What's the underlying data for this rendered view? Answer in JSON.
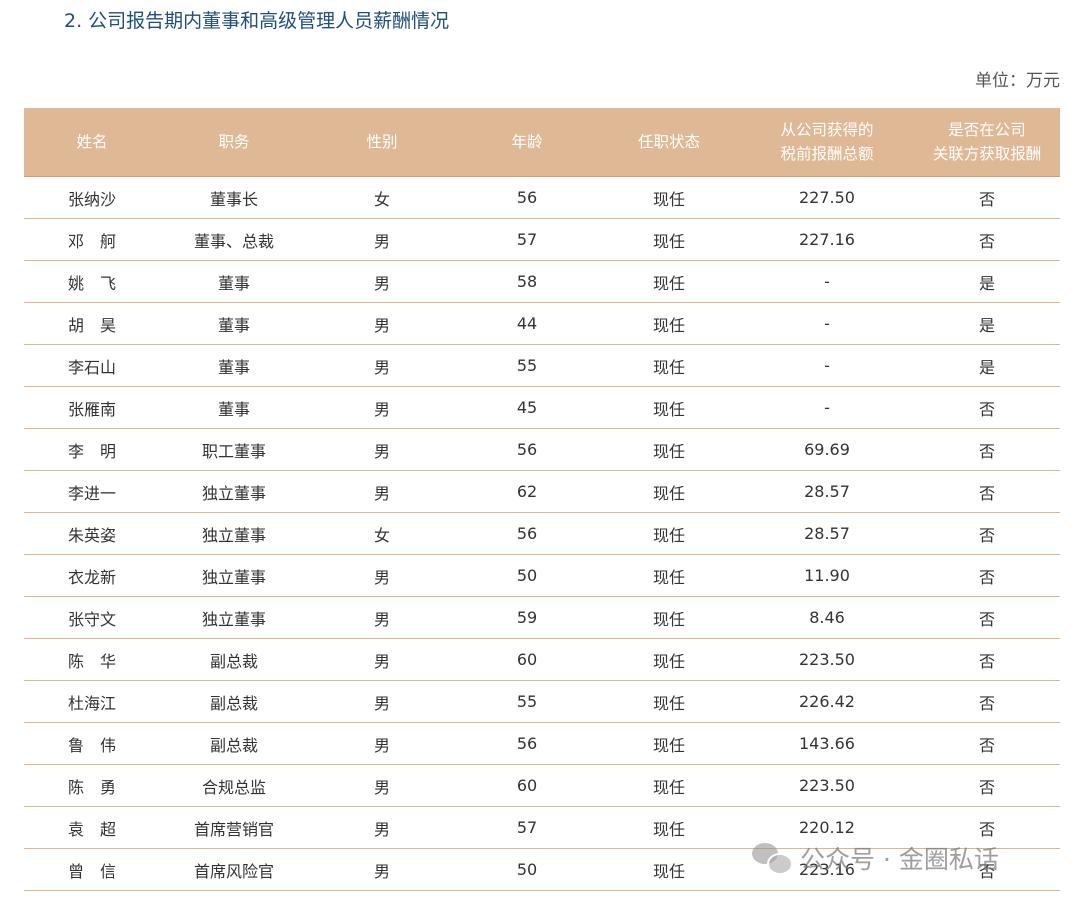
{
  "title": "2. 公司报告期内董事和高级管理人员薪酬情况",
  "unit": "单位：万元",
  "table": {
    "headers": [
      [
        "姓名"
      ],
      [
        "职务"
      ],
      [
        "性别"
      ],
      [
        "年龄"
      ],
      [
        "任职状态"
      ],
      [
        "从公司获得的",
        "税前报酬总额"
      ],
      [
        "是否在公司",
        "关联方获取报酬"
      ]
    ],
    "rows": [
      [
        "张纳沙",
        "董事长",
        "女",
        "56",
        "现任",
        "227.50",
        "否"
      ],
      [
        "邓　舸",
        "董事、总裁",
        "男",
        "57",
        "现任",
        "227.16",
        "否"
      ],
      [
        "姚　飞",
        "董事",
        "男",
        "58",
        "现任",
        "-",
        "是"
      ],
      [
        "胡　昊",
        "董事",
        "男",
        "44",
        "现任",
        "-",
        "是"
      ],
      [
        "李石山",
        "董事",
        "男",
        "55",
        "现任",
        "-",
        "是"
      ],
      [
        "张雁南",
        "董事",
        "男",
        "45",
        "现任",
        "-",
        "否"
      ],
      [
        "李　明",
        "职工董事",
        "男",
        "56",
        "现任",
        "69.69",
        "否"
      ],
      [
        "李进一",
        "独立董事",
        "男",
        "62",
        "现任",
        "28.57",
        "否"
      ],
      [
        "朱英姿",
        "独立董事",
        "女",
        "56",
        "现任",
        "28.57",
        "否"
      ],
      [
        "衣龙新",
        "独立董事",
        "男",
        "50",
        "现任",
        "11.90",
        "否"
      ],
      [
        "张守文",
        "独立董事",
        "男",
        "59",
        "现任",
        "8.46",
        "否"
      ],
      [
        "陈　华",
        "副总裁",
        "男",
        "60",
        "现任",
        "223.50",
        "否"
      ],
      [
        "杜海江",
        "副总裁",
        "男",
        "55",
        "现任",
        "226.42",
        "否"
      ],
      [
        "鲁　伟",
        "副总裁",
        "男",
        "56",
        "现任",
        "143.66",
        "否"
      ],
      [
        "陈　勇",
        "合规总监",
        "男",
        "60",
        "现任",
        "223.50",
        "否"
      ],
      [
        "袁　超",
        "首席营销官",
        "男",
        "57",
        "现任",
        "220.12",
        "否"
      ],
      [
        "曾　信",
        "首席风险官",
        "男",
        "50",
        "现任",
        "223.16",
        "否"
      ]
    ]
  },
  "watermark": {
    "icon": "wechat-icon",
    "text": "公众号 · 金圈私话"
  }
}
